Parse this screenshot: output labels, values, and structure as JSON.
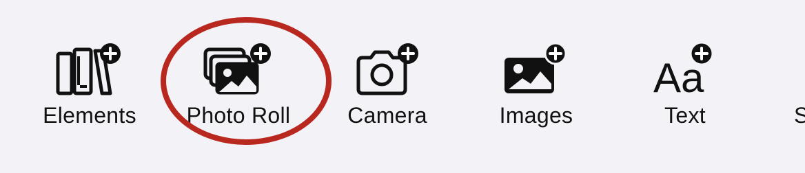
{
  "toolbar": {
    "items": [
      {
        "label": "Elements",
        "icon": "books-plus-icon"
      },
      {
        "label": "Photo Roll",
        "icon": "photo-stack-plus-icon"
      },
      {
        "label": "Camera",
        "icon": "camera-plus-icon"
      },
      {
        "label": "Images",
        "icon": "photo-plus-icon"
      },
      {
        "label": "Text",
        "icon": "text-format-plus-icon"
      }
    ],
    "partial_label": "S"
  },
  "annotation": {
    "shape": "ellipse",
    "color": "#b8281e",
    "target": "Photo Roll"
  },
  "colors": {
    "background": "#f2f2f7",
    "icon": "#111111",
    "annotation": "#b8281e"
  }
}
